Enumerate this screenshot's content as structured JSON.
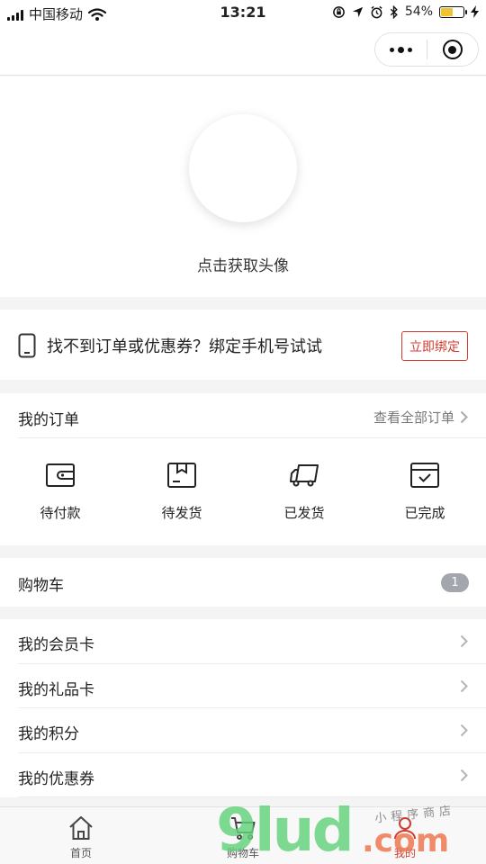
{
  "status_bar": {
    "carrier": "中国移动",
    "time": "13:21",
    "battery_percent": "54%",
    "battery_level": 0.54,
    "icons": [
      "signal-icon",
      "wifi-icon",
      "rotation-lock-icon",
      "location-icon",
      "alarm-icon",
      "bluetooth-icon",
      "battery-icon",
      "charging-icon"
    ]
  },
  "nav_capsule": {
    "icons": [
      "more-icon",
      "close-mini-program-icon"
    ]
  },
  "profile": {
    "avatar_label": "点击获取头像"
  },
  "bind_phone": {
    "text": "找不到订单或优惠券？绑定手机号试试",
    "button": "立即绑定",
    "accent": "#d23b2e"
  },
  "orders": {
    "title": "我的订单",
    "view_all": "查看全部订单",
    "statuses": [
      {
        "label": "待付款",
        "icon": "wallet-icon"
      },
      {
        "label": "待发货",
        "icon": "package-icon"
      },
      {
        "label": "已发货",
        "icon": "truck-icon"
      },
      {
        "label": "已完成",
        "icon": "completed-icon"
      }
    ]
  },
  "cart": {
    "label": "购物车",
    "count": "1"
  },
  "menu": [
    {
      "label": "我的会员卡"
    },
    {
      "label": "我的礼品卡"
    },
    {
      "label": "我的积分"
    },
    {
      "label": "我的优惠券"
    }
  ],
  "tabbar": [
    {
      "label": "首页",
      "icon": "home-icon"
    },
    {
      "label": "购物车",
      "icon": "cart-icon"
    },
    {
      "label": "我的",
      "icon": "profile-icon"
    }
  ],
  "watermark": {
    "brand": "9lud",
    "domain": ".com",
    "tagline": "小程序商店"
  }
}
